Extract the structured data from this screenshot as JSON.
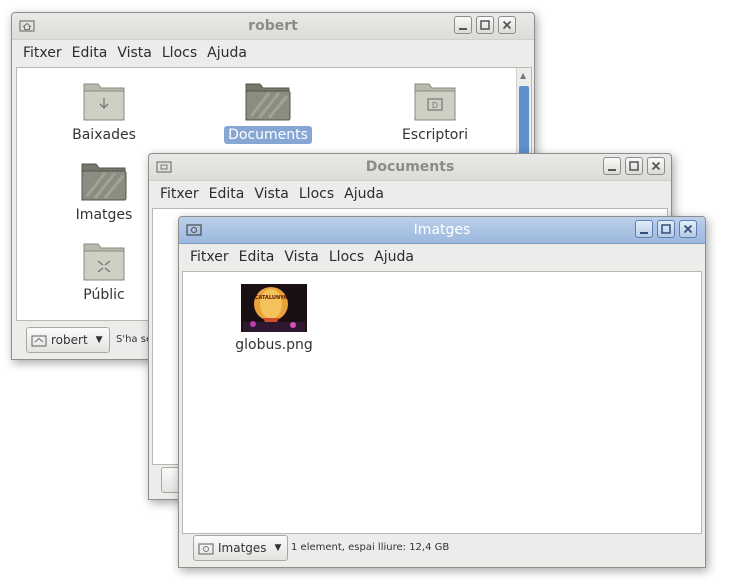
{
  "menu": [
    "Fitxer",
    "Edita",
    "Vista",
    "Llocs",
    "Ajuda"
  ],
  "robert": {
    "title": "robert",
    "items": [
      {
        "label": "Baixades",
        "icon": "download-folder-icon"
      },
      {
        "label": "Documents",
        "icon": "documents-folder-icon"
      },
      {
        "label": "Escriptori",
        "icon": "desktop-folder-icon"
      },
      {
        "label": "Imatges",
        "icon": "pictures-folder-icon"
      },
      {
        "label": "Públic",
        "icon": "public-folder-icon"
      }
    ],
    "location": "robert",
    "status": "S'ha se"
  },
  "documents": {
    "title": "Documents"
  },
  "imatges": {
    "title": "Imatges",
    "file": {
      "label": "globus.png",
      "thumb_text": "CATALUNYA"
    },
    "location": "Imatges",
    "status": "1 element, espai lliure: 12,4 GB"
  },
  "colors": {
    "accent": "#86a7d4",
    "active_title": "#9bb8de",
    "scroll_thumb": "#5d8fd0"
  }
}
